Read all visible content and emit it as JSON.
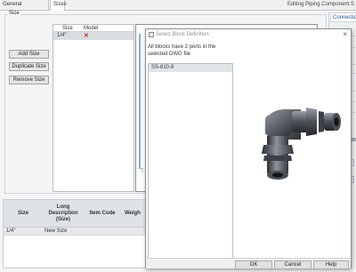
{
  "tabs": [
    {
      "label": "General Properties"
    },
    {
      "label": "Sizes"
    }
  ],
  "window_title": "Editing Piping Component S",
  "size_group": {
    "label": "Size",
    "add_label": "Add Size",
    "duplicate_label": "Duplicate Size",
    "remove_label": "Remove Size"
  },
  "sizes_table": {
    "headers": [
      "Size",
      "Model"
    ],
    "rows": [
      {
        "size": "1/4\"",
        "model_status": "✕"
      }
    ]
  },
  "preview_mark": "T",
  "right_panel": {
    "tab_label": "Connectio"
  },
  "bottom_table": {
    "headers": [
      "Size",
      "Long Description (Size)",
      "Item Code",
      "Weigh"
    ],
    "rows": [
      {
        "size": "1/4\"",
        "long_description": "New Size"
      }
    ]
  },
  "dialog": {
    "title": "Select Block Definition",
    "close_icon": "×",
    "message": "All blocks have 2 ports in the selected DWG file",
    "list_items": [
      "SS-810-9"
    ],
    "preview_icon": "elbow-fitting-image",
    "ok_label": "OK",
    "cancel_label": "Cancel",
    "help_label": "Help"
  },
  "colors": {
    "model_error": "#d71e1e",
    "accent_teal": "#7fb6bf",
    "tab_link": "#1d4f8a"
  }
}
